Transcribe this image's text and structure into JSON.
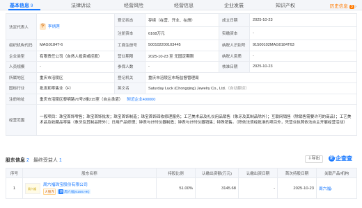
{
  "tabs": [
    {
      "label": "基本信息",
      "count": "9"
    },
    {
      "label": "法律诉讼",
      "count": ""
    },
    {
      "label": "经营风险",
      "count": ""
    },
    {
      "label": "经营信息",
      "count": ""
    },
    {
      "label": "企业发展",
      "count": ""
    },
    {
      "label": "知识产权",
      "count": ""
    }
  ],
  "history": {
    "label": "历史信息",
    "count": "3",
    "chevron": "›"
  },
  "info": {
    "legal_rep_label": "法定代表人",
    "legal_rep_initial": "李",
    "legal_rep_name": "李炳莲",
    "status_label": "登记状态",
    "status_value": "存续（在营、开业、在册）",
    "est_date_label": "成立日期",
    "est_date_value": "2025-10-23",
    "reg_capital_label": "注册资本",
    "reg_capital_value": "6168万元",
    "paid_capital_label": "实缴资本",
    "paid_capital_value": "-",
    "org_code_label": "组织机构代码",
    "org_code_value": "MAG0184T-6",
    "biz_reg_label": "工商注册号",
    "biz_reg_value": "500102200103445",
    "taxpayer_id_label": "纳税人识别号",
    "taxpayer_id_value": "91500102MAG0184T63",
    "type_label": "企业类型",
    "type_value": "有限责任公司（自然人投资或控股）",
    "term_label": "营业期限",
    "term_value": "2025-10-23 至 无固定期限",
    "taxpayer_q_label": "纳税人资质",
    "taxpayer_q_value": "-",
    "staff_label": "人员规模",
    "staff_value": "-",
    "insured_label": "参保人数",
    "insured_value": "-",
    "approval_label": "核准日期",
    "approval_value": "2025-10-23",
    "region_label": "所属地区",
    "region_value": "重庆市涪陵区",
    "authority_label": "登记机关",
    "authority_value": "重庆市涪陵区市场监督管理局",
    "industry_label": "国标行业",
    "industry_value": "批发和零售业（F）",
    "en_name_label": "英文名",
    "en_name_value": "Saturday Luck (Chongqing) Jewelry Co., Ltd.",
    "en_name_note": "（自动翻译）",
    "address_label": "注册地址",
    "address_value": "重庆市涪陵区黎明路70号2楼215室（自主承诺）",
    "address_nearby": "附近企业400000",
    "scope_label": "经营范围",
    "scope_value": "一般项目：珠宝首饰零售；珠宝首饰批发；珠宝首饰制造；珠宝首饰回收修理服务；工艺美术品及礼仪用品销售（象牙及其制品除外）；互联网销售（除销售需要许可的商品）；工艺美术品及收藏品零售（象牙及其制品除外）；日用产品修理；钟表与计时仪器制造；钟表与计时仪器销售；特殊销售。（除依法须经批准的项目外，凭营业执照依法自主开展经营活动）"
  },
  "shareholders": {
    "title": "股东信息",
    "count": "2",
    "sub_label": "最终受益人",
    "sub_count": "1",
    "export_icon": "export-icon",
    "export_label": "导出",
    "brand_label": "企查查",
    "brand_char": "企",
    "columns": [
      "序号",
      "股东名称",
      "持股比例",
      "认缴出资额(万元)",
      "认缴出资日期",
      "首次持股日期",
      "关联产品/机构"
    ],
    "rows": [
      {
        "index": "1",
        "logo_text": "周六福",
        "name": "周六福珠宝股份有限公司",
        "tag_big": "大股东",
        "stock_market": "港",
        "stock_label": "周六福(6168.HK)",
        "ratio": "51.00%",
        "amount": "3145.68",
        "sub_date": "-",
        "first_date": "2025-10-23",
        "product": "周六福",
        "chain_icon": "›"
      }
    ]
  },
  "colors": {
    "accent": "#1677ff",
    "warning": "#ff7a00"
  }
}
